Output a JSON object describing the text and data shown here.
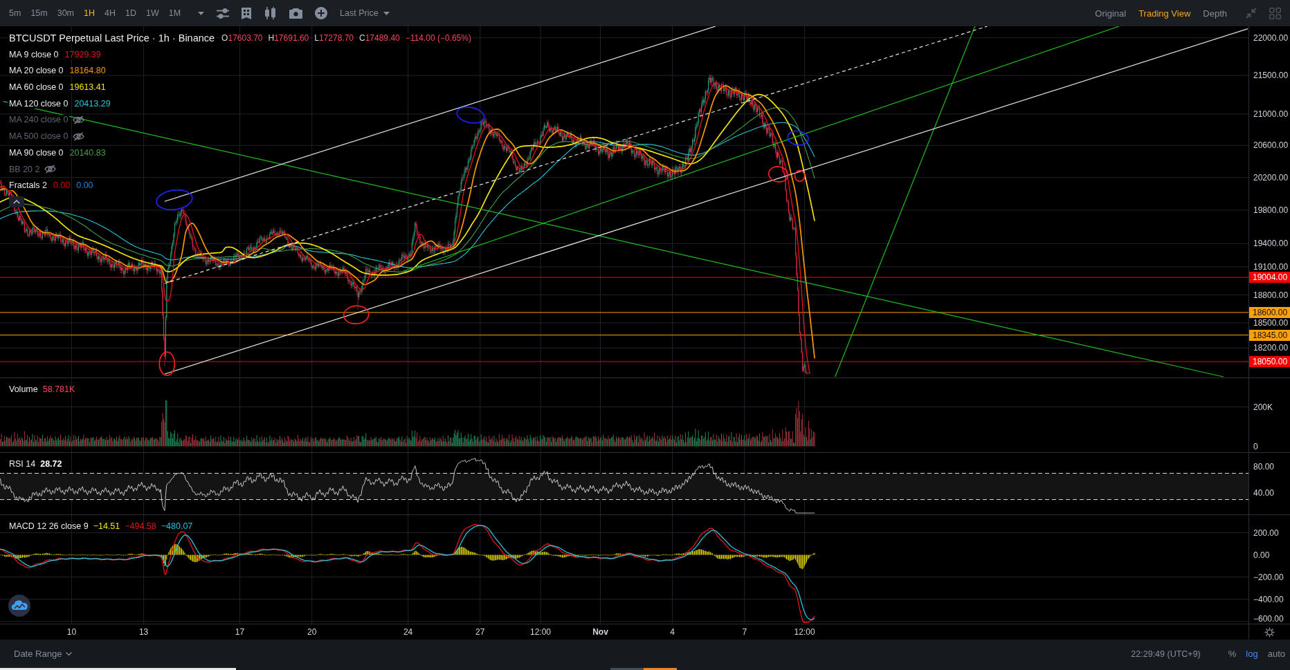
{
  "toolbar": {
    "intervals": [
      {
        "label": "5m",
        "selected": false
      },
      {
        "label": "15m",
        "selected": false
      },
      {
        "label": "30m",
        "selected": false
      },
      {
        "label": "1H",
        "selected": true
      },
      {
        "label": "4H",
        "selected": false
      },
      {
        "label": "1D",
        "selected": false
      },
      {
        "label": "1W",
        "selected": false
      },
      {
        "label": "1M",
        "selected": false
      }
    ],
    "price_type": "Last Price",
    "views": [
      {
        "label": "Original",
        "selected": false
      },
      {
        "label": "Trading View",
        "selected": true
      },
      {
        "label": "Depth",
        "selected": false
      }
    ]
  },
  "main_pane": {
    "title": "BTCUSDT Perpetual Last Price · 1h · Binance",
    "ohlc": [
      {
        "key": "O",
        "value": "17603.70"
      },
      {
        "key": "H",
        "value": "17691.60"
      },
      {
        "key": "L",
        "value": "17278.70"
      },
      {
        "key": "C",
        "value": "17489.40"
      }
    ],
    "change": "−114.00 (−0.65%)",
    "indicators": [
      {
        "label": "MA 9 close 0",
        "hidden": false,
        "values": [
          {
            "text": "17929.39",
            "color": "#e8141c"
          }
        ]
      },
      {
        "label": "MA 20 close 0",
        "hidden": false,
        "values": [
          {
            "text": "18164.80",
            "color": "#ff9800"
          }
        ]
      },
      {
        "label": "MA 60 close 0",
        "hidden": false,
        "values": [
          {
            "text": "19613.41",
            "color": "#f5e50a"
          }
        ]
      },
      {
        "label": "MA 120 close 0",
        "hidden": false,
        "values": [
          {
            "text": "20413.29",
            "color": "#26c6da"
          }
        ]
      },
      {
        "label": "MA 240 close 0",
        "hidden": true
      },
      {
        "label": "MA 500 close 0",
        "hidden": true
      },
      {
        "label": "MA 90 close 0",
        "hidden": false,
        "values": [
          {
            "text": "20140.83",
            "color": "#43a047"
          }
        ]
      },
      {
        "label": "BB 20 2",
        "hidden": true
      },
      {
        "label": "Fractals 2",
        "hidden": false,
        "values": [
          {
            "text": "0.00",
            "color": "#e00000"
          },
          {
            "text": "0.00",
            "color": "#1e88e5"
          }
        ]
      }
    ]
  },
  "price_axis": {
    "ticks": [
      "22000.00",
      "21500.00",
      "21000.00",
      "20600.00",
      "20200.00",
      "19800.00",
      "19400.00",
      "19100.00",
      "18800.00",
      "18500.00",
      "18200.00"
    ],
    "badges": [
      {
        "label": "19004.00",
        "color": "#f70000"
      },
      {
        "label": "18600.00",
        "color": "#ff9f0a"
      },
      {
        "label": "18345.00",
        "color": "#ff9f0a"
      },
      {
        "label": "18050.00",
        "color": "#f70000"
      }
    ]
  },
  "volume_pane": {
    "label": "Volume",
    "value": "58.781K",
    "axis": [
      "200K",
      "0"
    ]
  },
  "rsi_pane": {
    "label": "RSI 14",
    "value": "28.72",
    "axis": [
      "80.00",
      "40.00"
    ]
  },
  "macd_pane": {
    "label": "MACD 12 26 close 9",
    "values": [
      {
        "text": "−14.51",
        "color": "#f5e50a"
      },
      {
        "text": "−494.58",
        "color": "#e8141c"
      },
      {
        "text": "−480.07",
        "color": "#26c6da"
      }
    ],
    "axis": [
      "200.00",
      "0.00",
      "−200.00",
      "−400.00",
      "−600.00"
    ]
  },
  "time_axis": [
    {
      "label": "10",
      "kind": "day"
    },
    {
      "label": "13",
      "kind": "day"
    },
    {
      "label": "17",
      "kind": "day"
    },
    {
      "label": "20",
      "kind": "day"
    },
    {
      "label": "24",
      "kind": "day"
    },
    {
      "label": "27",
      "kind": "day"
    },
    {
      "label": "12:00",
      "kind": "time"
    },
    {
      "label": "Nov",
      "kind": "month"
    },
    {
      "label": "4",
      "kind": "day"
    },
    {
      "label": "7",
      "kind": "day"
    },
    {
      "label": "12:00",
      "kind": "time"
    }
  ],
  "status_bar": {
    "date_range": "Date Range",
    "clock": "22:29:49 (UTC+9)",
    "scale_options": [
      {
        "label": "%",
        "selected": false
      },
      {
        "label": "log",
        "selected": true
      },
      {
        "label": "auto",
        "selected": false
      }
    ]
  }
}
